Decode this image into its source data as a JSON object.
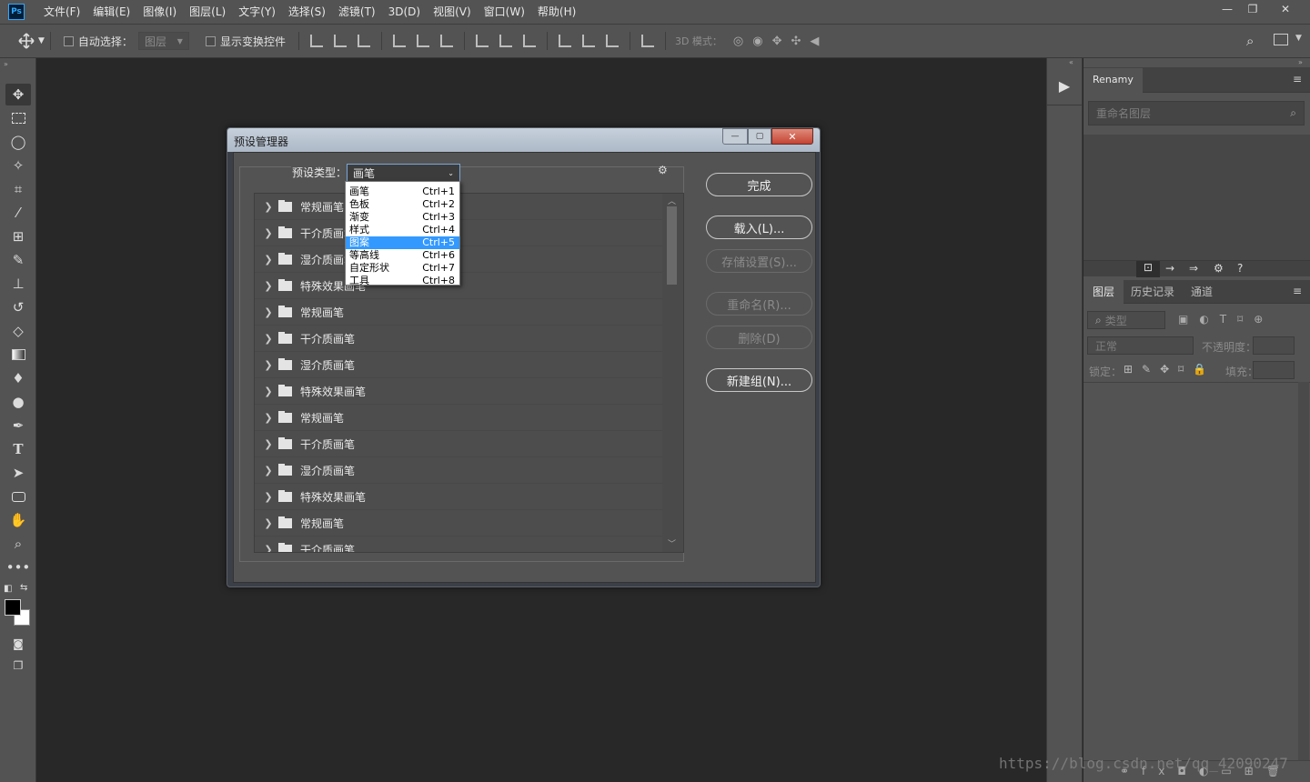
{
  "menubar": {
    "logo": "Ps",
    "items": [
      "文件(F)",
      "编辑(E)",
      "图像(I)",
      "图层(L)",
      "文字(Y)",
      "选择(S)",
      "滤镜(T)",
      "3D(D)",
      "视图(V)",
      "窗口(W)",
      "帮助(H)"
    ],
    "window_buttons": {
      "minimize": "—",
      "restore": "❐",
      "close": "✕"
    }
  },
  "options_bar": {
    "auto_select_label": "自动选择：",
    "auto_select_value": "图层",
    "show_transform_label": "显示变换控件",
    "mode_3d_label": "3D 模式："
  },
  "right_panel": {
    "renamy_tab": "Renamy",
    "rename_placeholder": "重命名图层",
    "layer_tabs": [
      "图层",
      "历史记录",
      "通道"
    ],
    "filter_kind": "类型",
    "blend_mode": "正常",
    "opacity_label": "不透明度：",
    "lock_label": "锁定：",
    "fill_label": "填充："
  },
  "dialog": {
    "title": "预设管理器",
    "preset_type_label": "预设类型：",
    "preset_type_value": "画笔",
    "buttons": {
      "done": "完成",
      "load": "载入(L)...",
      "save": "存储设置(S)...",
      "rename": "重命名(R)...",
      "delete": "删除(D)",
      "new_group": "新建组(N)..."
    },
    "rows": [
      "常规画笔",
      "干介质画笔",
      "湿介质画笔",
      "特殊效果画笔",
      "常规画笔",
      "干介质画笔",
      "湿介质画笔",
      "特殊效果画笔",
      "常规画笔",
      "干介质画笔",
      "湿介质画笔",
      "特殊效果画笔",
      "常规画笔",
      "干介质画笔"
    ],
    "popup": [
      {
        "label": "画笔",
        "shortcut": "Ctrl+1"
      },
      {
        "label": "色板",
        "shortcut": "Ctrl+2"
      },
      {
        "label": "渐变",
        "shortcut": "Ctrl+3"
      },
      {
        "label": "样式",
        "shortcut": "Ctrl+4"
      },
      {
        "label": "图案",
        "shortcut": "Ctrl+5",
        "selected": true
      },
      {
        "label": "等高线",
        "shortcut": "Ctrl+6"
      },
      {
        "label": "自定形状",
        "shortcut": "Ctrl+7"
      },
      {
        "label": "工具",
        "shortcut": "Ctrl+8"
      }
    ]
  },
  "watermark": "https://blog.csdn.net/qq_42090247"
}
